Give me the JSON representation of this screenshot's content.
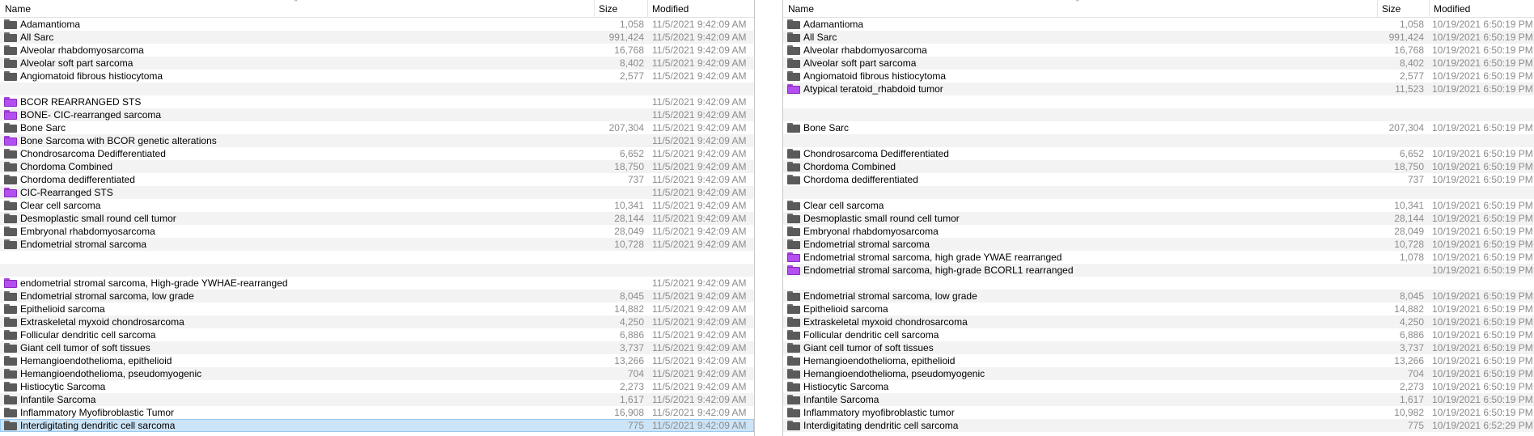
{
  "left_pane": {
    "columns": {
      "name": "Name",
      "size": "Size",
      "modified": "Modified"
    },
    "rows": [
      {
        "name": "Adamantioma",
        "size": "1,058",
        "modified": "11/5/2021 9:42:09 AM",
        "icon": "gray"
      },
      {
        "name": "All Sarc",
        "size": "991,424",
        "modified": "11/5/2021 9:42:09 AM",
        "icon": "gray"
      },
      {
        "name": "Alveolar rhabdomyosarcoma",
        "size": "16,768",
        "modified": "11/5/2021 9:42:09 AM",
        "icon": "gray"
      },
      {
        "name": "Alveolar soft part sarcoma",
        "size": "8,402",
        "modified": "11/5/2021 9:42:09 AM",
        "icon": "gray"
      },
      {
        "name": "Angiomatoid fibrous histiocytoma",
        "size": "2,577",
        "modified": "11/5/2021 9:42:09 AM",
        "icon": "gray"
      },
      {
        "name": "",
        "size": "",
        "modified": "",
        "icon": "none"
      },
      {
        "name": "BCOR REARRANGED STS",
        "size": "",
        "modified": "11/5/2021 9:42:09 AM",
        "icon": "purple"
      },
      {
        "name": "BONE- CIC-rearranged sarcoma",
        "size": "",
        "modified": "11/5/2021 9:42:09 AM",
        "icon": "purple"
      },
      {
        "name": "Bone Sarc",
        "size": "207,304",
        "modified": "11/5/2021 9:42:09 AM",
        "icon": "gray"
      },
      {
        "name": "Bone Sarcoma with BCOR genetic alterations",
        "size": "",
        "modified": "11/5/2021 9:42:09 AM",
        "icon": "purple"
      },
      {
        "name": "Chondrosarcoma Dedifferentiated",
        "size": "6,652",
        "modified": "11/5/2021 9:42:09 AM",
        "icon": "gray"
      },
      {
        "name": "Chordoma Combined",
        "size": "18,750",
        "modified": "11/5/2021 9:42:09 AM",
        "icon": "gray"
      },
      {
        "name": "Chordoma dedifferentiated",
        "size": "737",
        "modified": "11/5/2021 9:42:09 AM",
        "icon": "gray"
      },
      {
        "name": "CIC-Rearranged STS",
        "size": "",
        "modified": "11/5/2021 9:42:09 AM",
        "icon": "purple"
      },
      {
        "name": "Clear cell sarcoma",
        "size": "10,341",
        "modified": "11/5/2021 9:42:09 AM",
        "icon": "gray"
      },
      {
        "name": "Desmoplastic small round cell tumor",
        "size": "28,144",
        "modified": "11/5/2021 9:42:09 AM",
        "icon": "gray"
      },
      {
        "name": "Embryonal rhabdomyosarcoma",
        "size": "28,049",
        "modified": "11/5/2021 9:42:09 AM",
        "icon": "gray"
      },
      {
        "name": "Endometrial stromal sarcoma",
        "size": "10,728",
        "modified": "11/5/2021 9:42:09 AM",
        "icon": "gray"
      },
      {
        "name": "",
        "size": "",
        "modified": "",
        "icon": "none"
      },
      {
        "name": "",
        "size": "",
        "modified": "",
        "icon": "none"
      },
      {
        "name": "endometrial stromal sarcoma, High-grade YWHAE-rearranged",
        "size": "",
        "modified": "11/5/2021 9:42:09 AM",
        "icon": "purple"
      },
      {
        "name": "Endometrial stromal sarcoma, low grade",
        "size": "8,045",
        "modified": "11/5/2021 9:42:09 AM",
        "icon": "gray"
      },
      {
        "name": "Epithelioid sarcoma",
        "size": "14,882",
        "modified": "11/5/2021 9:42:09 AM",
        "icon": "gray"
      },
      {
        "name": "Extraskeletal myxoid chondrosarcoma",
        "size": "4,250",
        "modified": "11/5/2021 9:42:09 AM",
        "icon": "gray"
      },
      {
        "name": "Follicular dendritic cell sarcoma",
        "size": "6,886",
        "modified": "11/5/2021 9:42:09 AM",
        "icon": "gray"
      },
      {
        "name": "Giant cell tumor of soft tissues",
        "size": "3,737",
        "modified": "11/5/2021 9:42:09 AM",
        "icon": "gray"
      },
      {
        "name": "Hemangioendothelioma, epithelioid",
        "size": "13,266",
        "modified": "11/5/2021 9:42:09 AM",
        "icon": "gray"
      },
      {
        "name": "Hemangioendothelioma, pseudomyogenic",
        "size": "704",
        "modified": "11/5/2021 9:42:09 AM",
        "icon": "gray"
      },
      {
        "name": "Histiocytic Sarcoma",
        "size": "2,273",
        "modified": "11/5/2021 9:42:09 AM",
        "icon": "gray"
      },
      {
        "name": "Infantile Sarcoma",
        "size": "1,617",
        "modified": "11/5/2021 9:42:09 AM",
        "icon": "gray"
      },
      {
        "name": "Inflammatory Myofibroblastic Tumor",
        "size": "16,908",
        "modified": "11/5/2021 9:42:09 AM",
        "icon": "gray"
      },
      {
        "name": "Interdigitating dendritic cell sarcoma",
        "size": "775",
        "modified": "11/5/2021 9:42:09 AM",
        "icon": "gray",
        "selected": true
      }
    ]
  },
  "right_pane": {
    "columns": {
      "name": "Name",
      "size": "Size",
      "modified": "Modified"
    },
    "rows": [
      {
        "name": "Adamantioma",
        "size": "1,058",
        "modified": "10/19/2021 6:50:19 PM",
        "icon": "gray"
      },
      {
        "name": "All Sarc",
        "size": "991,424",
        "modified": "10/19/2021 6:50:19 PM",
        "icon": "gray"
      },
      {
        "name": "Alveolar rhabdomyosarcoma",
        "size": "16,768",
        "modified": "10/19/2021 6:50:19 PM",
        "icon": "gray"
      },
      {
        "name": "Alveolar soft part sarcoma",
        "size": "8,402",
        "modified": "10/19/2021 6:50:19 PM",
        "icon": "gray"
      },
      {
        "name": "Angiomatoid fibrous histiocytoma",
        "size": "2,577",
        "modified": "10/19/2021 6:50:19 PM",
        "icon": "gray"
      },
      {
        "name": "Atypical teratoid_rhabdoid tumor",
        "size": "11,523",
        "modified": "10/19/2021 6:50:19 PM",
        "icon": "purple"
      },
      {
        "name": "",
        "size": "",
        "modified": "",
        "icon": "none"
      },
      {
        "name": "",
        "size": "",
        "modified": "",
        "icon": "none"
      },
      {
        "name": "Bone Sarc",
        "size": "207,304",
        "modified": "10/19/2021 6:50:19 PM",
        "icon": "gray"
      },
      {
        "name": "",
        "size": "",
        "modified": "",
        "icon": "none"
      },
      {
        "name": "Chondrosarcoma Dedifferentiated",
        "size": "6,652",
        "modified": "10/19/2021 6:50:19 PM",
        "icon": "gray"
      },
      {
        "name": "Chordoma Combined",
        "size": "18,750",
        "modified": "10/19/2021 6:50:19 PM",
        "icon": "gray"
      },
      {
        "name": "Chordoma dedifferentiated",
        "size": "737",
        "modified": "10/19/2021 6:50:19 PM",
        "icon": "gray"
      },
      {
        "name": "",
        "size": "",
        "modified": "",
        "icon": "none"
      },
      {
        "name": "Clear cell sarcoma",
        "size": "10,341",
        "modified": "10/19/2021 6:50:19 PM",
        "icon": "gray"
      },
      {
        "name": "Desmoplastic small round cell tumor",
        "size": "28,144",
        "modified": "10/19/2021 6:50:19 PM",
        "icon": "gray"
      },
      {
        "name": "Embryonal rhabdomyosarcoma",
        "size": "28,049",
        "modified": "10/19/2021 6:50:19 PM",
        "icon": "gray"
      },
      {
        "name": "Endometrial stromal sarcoma",
        "size": "10,728",
        "modified": "10/19/2021 6:50:19 PM",
        "icon": "gray"
      },
      {
        "name": "Endometrial stromal sarcoma, high grade YWAE rearranged",
        "size": "1,078",
        "modified": "10/19/2021 6:50:19 PM",
        "icon": "purple"
      },
      {
        "name": "Endometrial stromal sarcoma, high-grade BCORL1 rearranged",
        "size": "",
        "modified": "10/19/2021 6:50:19 PM",
        "icon": "purple"
      },
      {
        "name": "",
        "size": "",
        "modified": "",
        "icon": "none"
      },
      {
        "name": "Endometrial stromal sarcoma, low grade",
        "size": "8,045",
        "modified": "10/19/2021 6:50:19 PM",
        "icon": "gray"
      },
      {
        "name": "Epithelioid sarcoma",
        "size": "14,882",
        "modified": "10/19/2021 6:50:19 PM",
        "icon": "gray"
      },
      {
        "name": "Extraskeletal myxoid chondrosarcoma",
        "size": "4,250",
        "modified": "10/19/2021 6:50:19 PM",
        "icon": "gray"
      },
      {
        "name": "Follicular dendritic cell sarcoma",
        "size": "6,886",
        "modified": "10/19/2021 6:50:19 PM",
        "icon": "gray"
      },
      {
        "name": "Giant cell tumor of soft tissues",
        "size": "3,737",
        "modified": "10/19/2021 6:50:19 PM",
        "icon": "gray"
      },
      {
        "name": "Hemangioendothelioma, epithelioid",
        "size": "13,266",
        "modified": "10/19/2021 6:50:19 PM",
        "icon": "gray"
      },
      {
        "name": "Hemangioendothelioma, pseudomyogenic",
        "size": "704",
        "modified": "10/19/2021 6:50:19 PM",
        "icon": "gray"
      },
      {
        "name": "Histiocytic Sarcoma",
        "size": "2,273",
        "modified": "10/19/2021 6:50:19 PM",
        "icon": "gray"
      },
      {
        "name": "Infantile Sarcoma",
        "size": "1,617",
        "modified": "10/19/2021 6:50:19 PM",
        "icon": "gray"
      },
      {
        "name": "Inflammatory myofibroblastic tumor",
        "size": "10,982",
        "modified": "10/19/2021 6:50:19 PM",
        "icon": "gray"
      },
      {
        "name": "Interdigitating dendritic cell sarcoma",
        "size": "775",
        "modified": "10/19/2021 6:52:29 PM",
        "icon": "gray"
      }
    ]
  },
  "colors": {
    "selection": "#cce4f7",
    "alt_row": "#f3f3f3",
    "folder_gray": "#5a5a5a",
    "folder_purple": "#b34ef0",
    "meta_text": "#8c8c8c"
  }
}
